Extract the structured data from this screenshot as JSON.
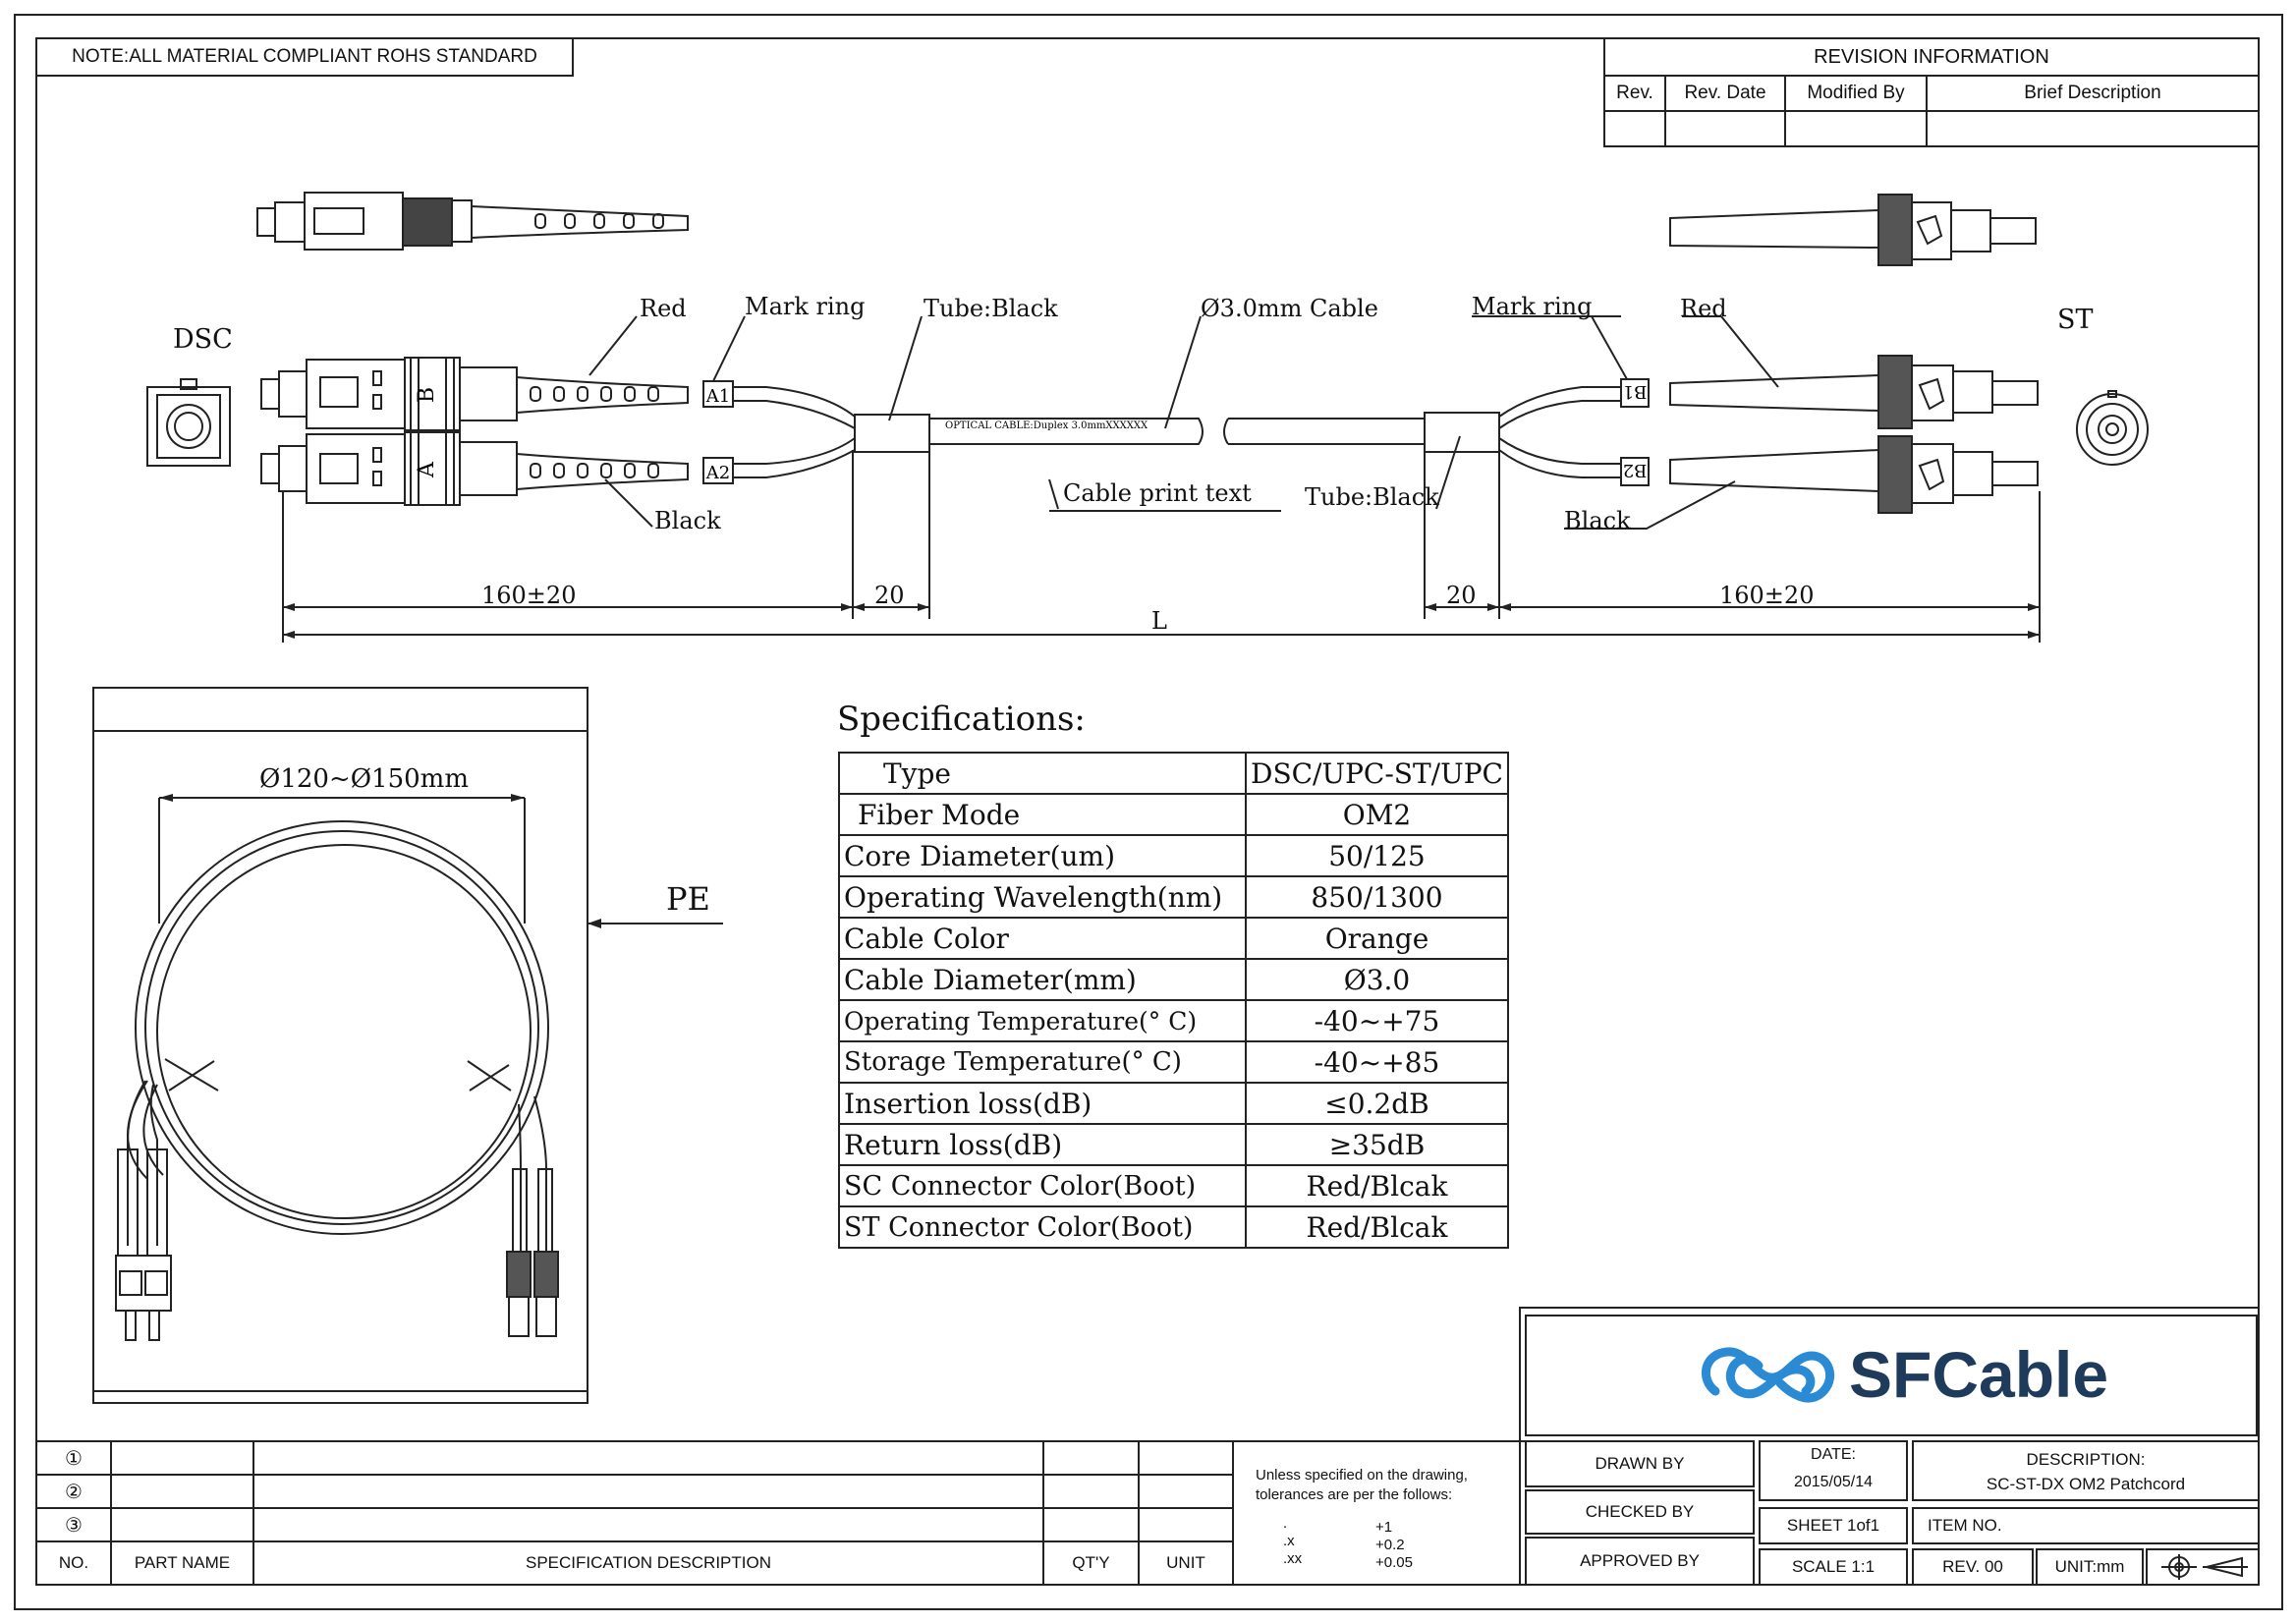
{
  "note": "NOTE:ALL MATERIAL COMPLIANT ROHS STANDARD",
  "revision": {
    "title": "REVISION INFORMATION",
    "headers": [
      "Rev.",
      "Rev. Date",
      "Modified By",
      "Brief Description"
    ]
  },
  "diagram": {
    "left_connector": "DSC",
    "right_connector": "ST",
    "labels": {
      "red_left": "Red",
      "mark_ring_left": "Mark ring",
      "tube_black_left": "Tube:Black",
      "cable": "Ø3.0mm Cable",
      "mark_ring_right": "Mark ring",
      "red_right": "Red",
      "black_left": "Black",
      "cable_print_text": "Cable print text",
      "tube_black_right": "Tube:Black",
      "black_right": "Black",
      "print_on_cable": "OPTICAL CABLE:Duplex 3.0mmXXXXXX"
    },
    "ring_marks": [
      "A1",
      "A2",
      "B1",
      "B2"
    ],
    "body_marks": [
      "B",
      "A"
    ],
    "dimensions": {
      "left_boot": "160±20",
      "left_tube": "20",
      "right_tube": "20",
      "right_boot": "160±20",
      "total": "L"
    }
  },
  "package": {
    "diameter": "Ø120~Ø150mm",
    "material": "PE"
  },
  "specifications": {
    "title": "Specifications:",
    "rows": [
      {
        "key": "Type",
        "value": "DSC/UPC-ST/UPC"
      },
      {
        "key": "Fiber Mode",
        "value": "OM2"
      },
      {
        "key": "Core Diameter(um)",
        "value": "50/125"
      },
      {
        "key": "Operating Wavelength(nm)",
        "value": "850/1300"
      },
      {
        "key": "Cable Color",
        "value": "Orange"
      },
      {
        "key": "Cable Diameter(mm)",
        "value": "Ø3.0"
      },
      {
        "key": "Operating Temperature(° C)",
        "value": "-40~+75"
      },
      {
        "key": "Storage Temperature(° C)",
        "value": "-40~+85"
      },
      {
        "key": "Insertion loss(dB)",
        "value": "≤0.2dB"
      },
      {
        "key": "Return loss(dB)",
        "value": "≥35dB"
      },
      {
        "key": "SC Connector Color(Boot)",
        "value": "Red/Blcak"
      },
      {
        "key": "ST Connector Color(Boot)",
        "value": "Red/Blcak"
      }
    ]
  },
  "parts_table": {
    "rows": [
      "①",
      "②",
      "③"
    ],
    "headers": [
      "NO.",
      "PART NAME",
      "SPECIFICATION DESCRIPTION",
      "QT'Y",
      "UNIT"
    ]
  },
  "tolerance": {
    "text": "Unless specified on the drawing, tolerances are per the follows:",
    "rows": [
      {
        "k": ".",
        "v": "+1"
      },
      {
        "k": ".x",
        "v": "+0.2"
      },
      {
        "k": ".xx",
        "v": "+0.05"
      }
    ]
  },
  "title_block": {
    "logo_text": "SFCable",
    "brand_color": "#2a8ad4",
    "text_color": "#1f3b5c",
    "drawn_by": "DRAWN BY",
    "checked_by": "CHECKED BY",
    "approved_by": "APPROVED BY",
    "date_label": "DATE:",
    "date": "2015/05/14",
    "description_label": "DESCRIPTION:",
    "description": "SC-ST-DX  OM2 Patchcord",
    "sheet": "SHEET 1of1",
    "item_no": "ITEM NO.",
    "scale": "SCALE 1:1",
    "rev": "REV. 00",
    "unit": "UNIT:mm"
  }
}
